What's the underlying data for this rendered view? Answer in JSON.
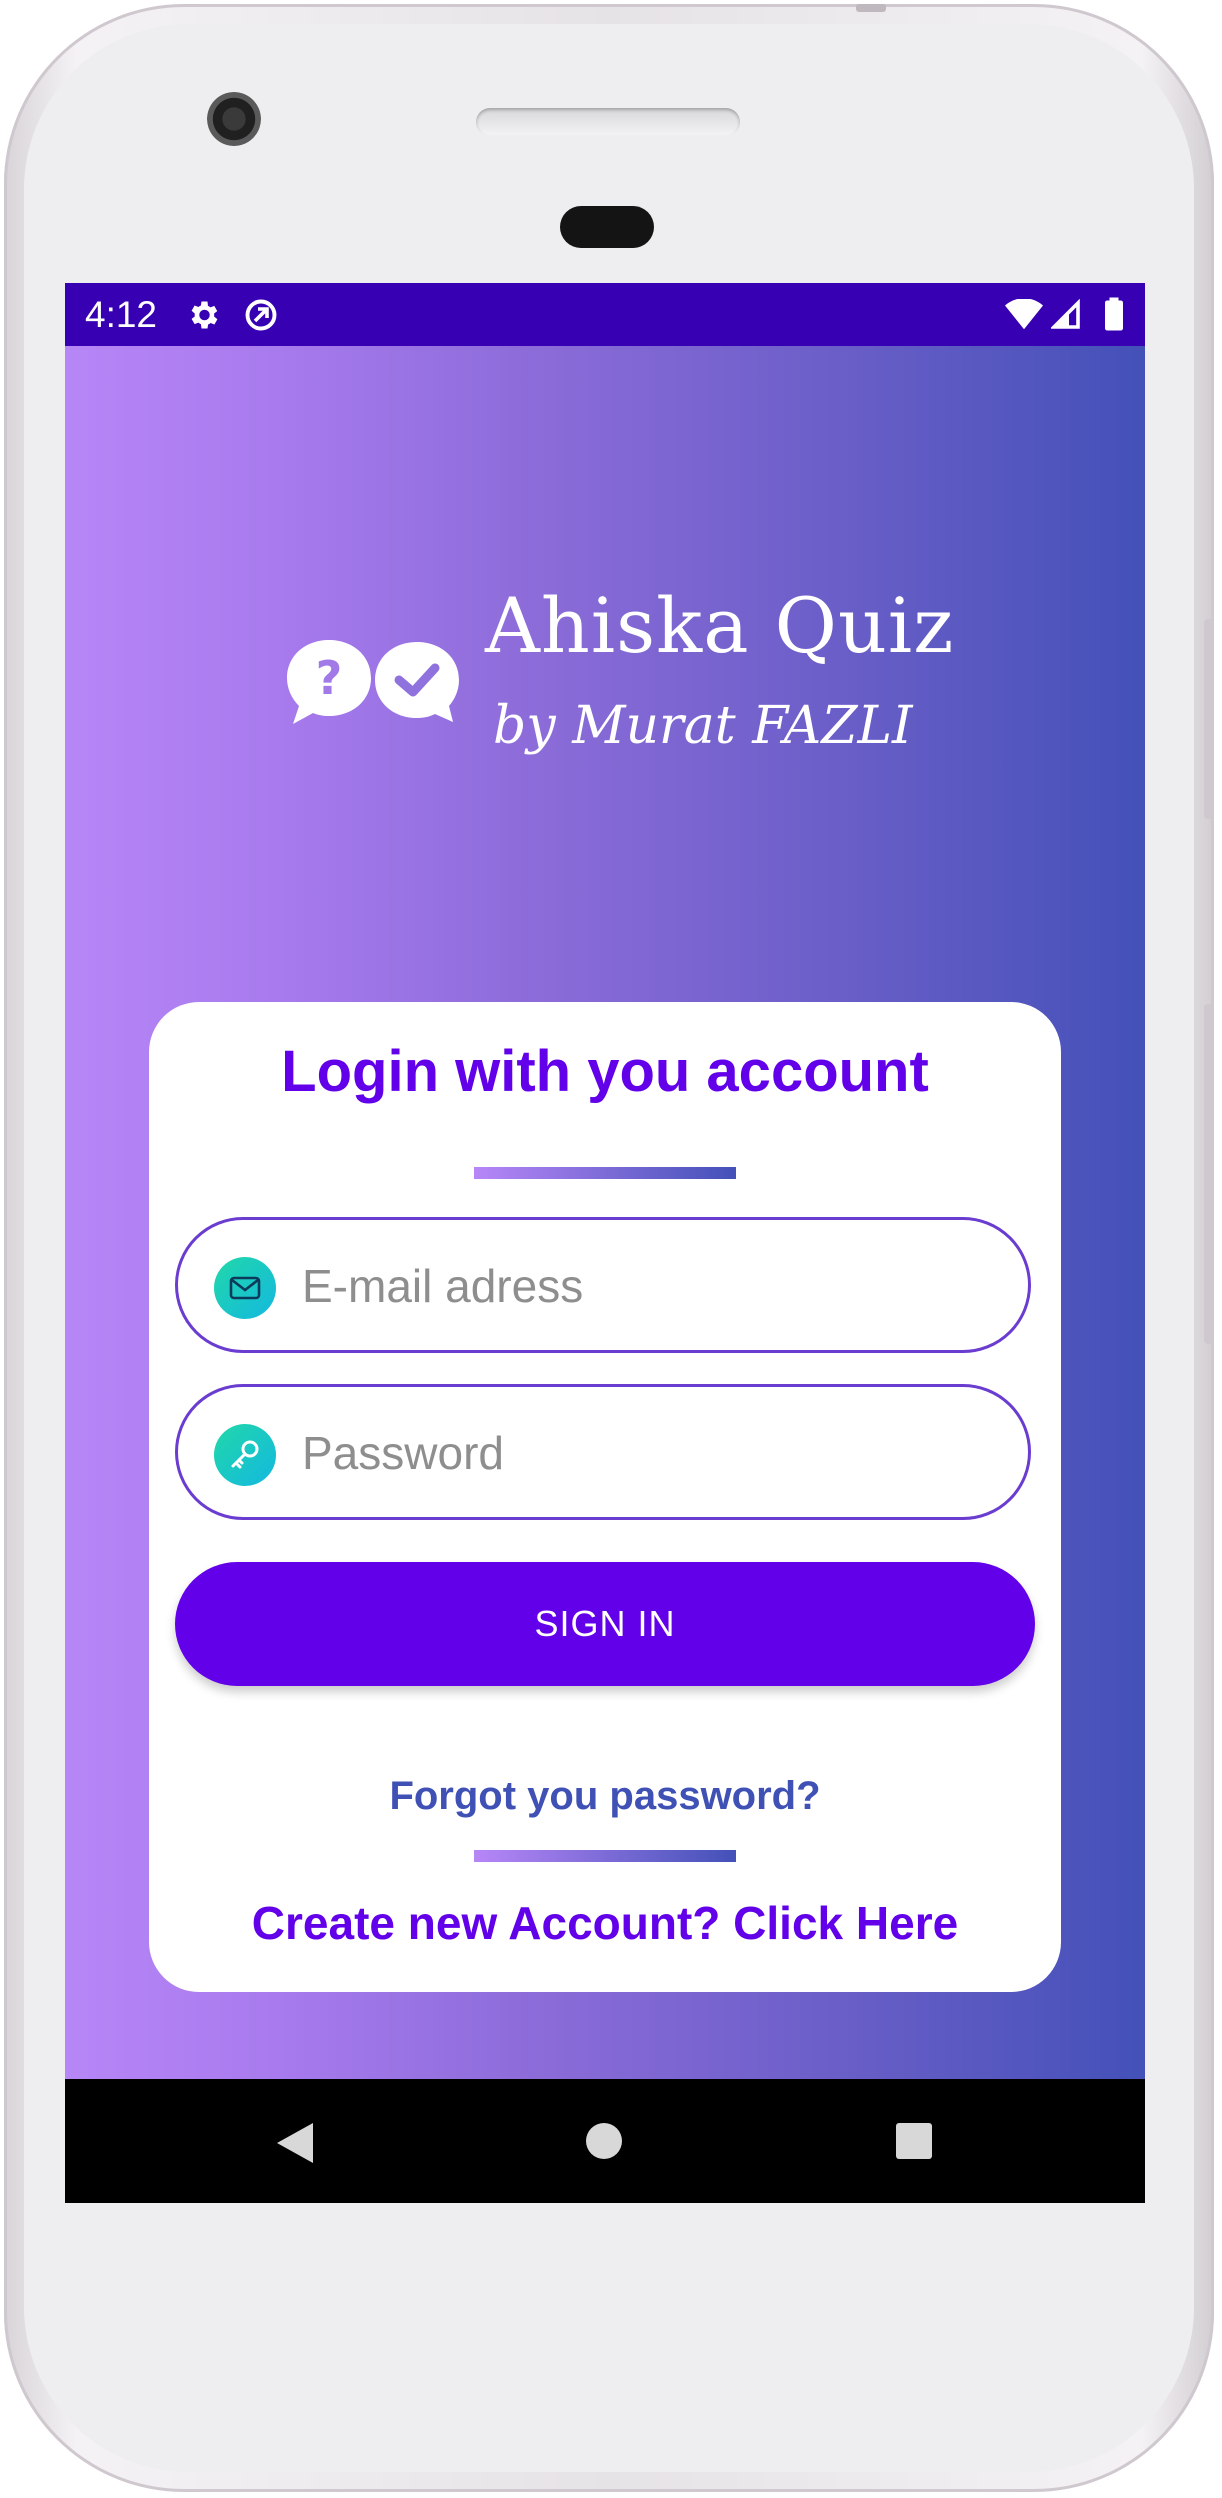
{
  "status_bar": {
    "time": "4:12",
    "icons": [
      "gear-icon",
      "sync-icon",
      "wifi-icon",
      "signal-icon",
      "battery-icon"
    ]
  },
  "header": {
    "app_title": "Ahiska Quiz",
    "subtitle": "by Murat FAZLI",
    "logo_icon": "chat-bubbles-quiz-icon"
  },
  "login": {
    "title": "Login with you account",
    "email_placeholder": "E-mail adress",
    "email_icon": "mail-icon",
    "password_placeholder": "Password",
    "password_icon": "key-icon",
    "signin_label": "SIGN IN",
    "forgot_label": "Forgot you password?",
    "create_label": "Create new Account? Click Here"
  },
  "nav_bar": {
    "icons": [
      "back-icon",
      "home-icon",
      "recents-icon"
    ]
  },
  "colors": {
    "primary": "#6200ea",
    "status_bar": "#3700b3",
    "gradient_start": "#b786f7",
    "gradient_end": "#4351b8",
    "link": "#3f51b5",
    "icon_gradient_start": "#20d8a8",
    "icon_gradient_end": "#14b8e0"
  }
}
